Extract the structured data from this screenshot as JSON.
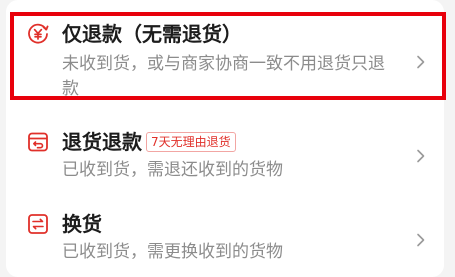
{
  "options": [
    {
      "title": "仅退款（无需退货）",
      "description": "未收到货，或与商家协商一致不用退货只退款",
      "icon": "yen-refund-icon"
    },
    {
      "title": "退货退款",
      "badge": "7天无理由退货",
      "description": "已收到货，需退还收到的货物",
      "icon": "return-box-icon"
    },
    {
      "title": "换货",
      "description": "已收到货，需更换收到的货物",
      "icon": "exchange-icon"
    }
  ],
  "colors": {
    "accent": "#e0302a",
    "highlight_border": "#e8000b",
    "title": "#1c1c1c",
    "description": "#8c8c8c"
  }
}
